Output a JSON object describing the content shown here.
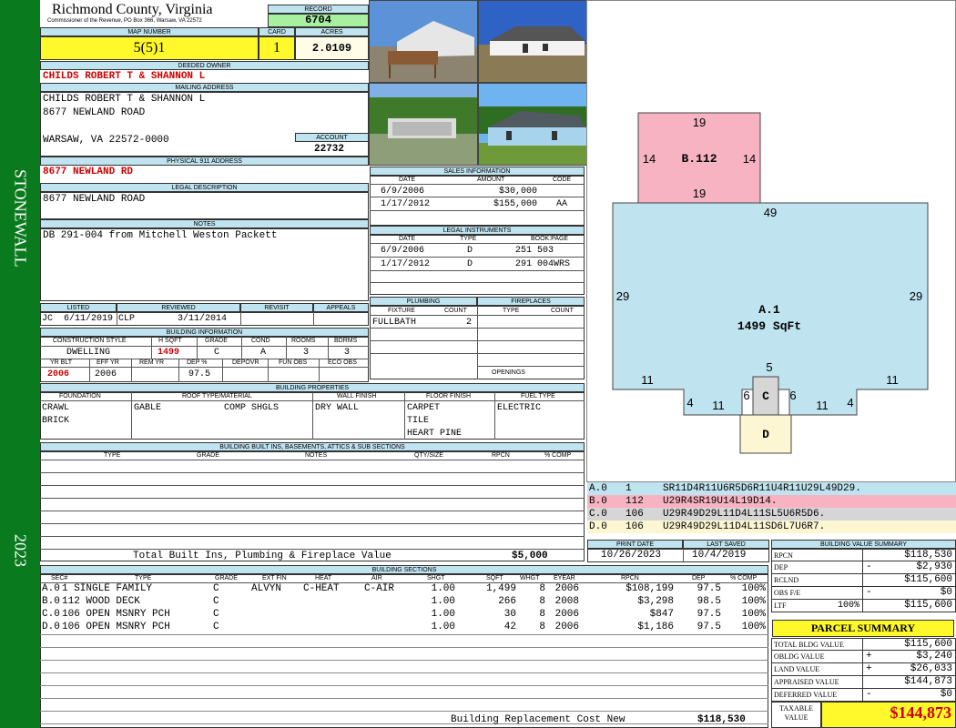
{
  "sidebar": {
    "district": "STONEWALL",
    "year": "2023"
  },
  "header": {
    "county": "Richmond County, Virginia",
    "commissioner": "Commissioner of the Revenue, PO Box 366, Warsaw, VA 22572",
    "record_label": "RECORD",
    "record": "6704",
    "map_label": "MAP NUMBER",
    "map_number": "5(5)1",
    "card_label": "CARD",
    "card": "1",
    "acres_label": "ACRES",
    "acres": "2.0109"
  },
  "owner": {
    "label": "DEEDED OWNER",
    "value": "CHILDS ROBERT T & SHANNON L"
  },
  "mailing": {
    "label": "MAILING ADDRESS",
    "line1": "CHILDS ROBERT T & SHANNON L",
    "line2": "8677 NEWLAND ROAD",
    "line3": "WARSAW, VA 22572-0000",
    "account_label": "ACCOUNT",
    "account": "22732"
  },
  "physical": {
    "label": "PHYSICAL 911 ADDRESS",
    "value": "8677 NEWLAND RD"
  },
  "legal": {
    "label": "LEGAL DESCRIPTION",
    "value": "8677 NEWLAND ROAD"
  },
  "notes": {
    "label": "NOTES",
    "value": "DB 291-004 from Mitchell Weston Packett"
  },
  "sales": {
    "label": "SALES INFORMATION",
    "headers": [
      "DATE",
      "AMOUNT",
      "CODE"
    ],
    "rows": [
      [
        "6/9/2006",
        "$30,000",
        ""
      ],
      [
        "1/17/2012",
        "$155,000",
        "AA"
      ]
    ]
  },
  "legal_instruments": {
    "label": "LEGAL INSTRUMENTS",
    "headers": [
      "DATE",
      "TYPE",
      "BOOK:PAGE"
    ],
    "rows": [
      [
        "6/9/2006",
        "D",
        "251 503"
      ],
      [
        "1/17/2012",
        "D",
        "291 004WRS"
      ]
    ]
  },
  "listing": {
    "headers": [
      "LISTED",
      "REVIEWED",
      "REVISIT",
      "APPEALS"
    ],
    "listed_by": "JC",
    "listed": "6/11/2019",
    "reviewed_by": "CLP",
    "reviewed": "3/11/2014"
  },
  "building_info": {
    "label": "BUILDING INFORMATION",
    "headers1": [
      "CONSTRUCTION STYLE",
      "H SQFT",
      "GRADE",
      "COND",
      "ROOMS",
      "BDRMS"
    ],
    "values1": [
      "DWELLING",
      "1499",
      "C",
      "A",
      "3",
      "3"
    ],
    "headers2": [
      "YR BLT",
      "EFF YR",
      "REM YR",
      "DEP %",
      "DEPOVR",
      "FUN OBS",
      "ECO OBS"
    ],
    "values2": [
      "2006",
      "2006",
      "",
      "97.5",
      "",
      "",
      ""
    ]
  },
  "plumbing": {
    "label": "PLUMBING",
    "headers": [
      "FIXTURE",
      "COUNT"
    ],
    "rows": [
      [
        "FULLBATH",
        "2"
      ]
    ]
  },
  "fireplaces": {
    "label": "FIREPLACES",
    "headers": [
      "TYPE",
      "COUNT"
    ],
    "openings_label": "OPENINGS"
  },
  "properties": {
    "label": "BUILDING PROPERTIES",
    "headers": [
      "FOUNDATION",
      "ROOF TYPE/MATERIAL",
      "WALL FINISH",
      "FLOOR FINISH",
      "FUEL TYPE"
    ],
    "foundation": [
      "CRAWL",
      "BRICK"
    ],
    "roof_type": "GABLE",
    "roof_material": "COMP SHGLS",
    "wall": "DRY WALL",
    "floor": [
      "CARPET",
      "TILE",
      "HEART PINE"
    ],
    "fuel": "ELECTRIC"
  },
  "builtins": {
    "label": "BUILDING BUILT INS, BASEMENTS, ATTICS & SUB SECTIONS",
    "headers": [
      "TYPE",
      "GRADE",
      "NOTES",
      "QTY/SIZE",
      "RPCN",
      "% COMP"
    ],
    "total_label": "Total Built Ins, Plumbing & Fireplace Value",
    "total": "$5,000"
  },
  "dates": {
    "print_label": "PRINT DATE",
    "print": "10/26/2023",
    "saved_label": "LAST SAVED",
    "saved": "10/4/2019"
  },
  "sketch": {
    "B": {
      "label": "B.112",
      "top": "19",
      "bottom": "19",
      "left": "14",
      "right": "14"
    },
    "A": {
      "label": "A.1",
      "area": "1499 SqFt",
      "top": "49",
      "left": "29",
      "right": "29",
      "b11l": "11",
      "b4l": "4",
      "b11lb": "11",
      "b11rb": "11",
      "b4r": "4",
      "b11r": "11"
    },
    "C": {
      "label": "C",
      "top": "5",
      "left": "6",
      "right": "6"
    },
    "D": {
      "label": "D"
    }
  },
  "sketch_codes": [
    {
      "sec": "A.0",
      "code": "1",
      "vec": "SR11D4R11U6R5D6R11U4R11U29L49D29.",
      "color": "#bfe3ef"
    },
    {
      "sec": "B.0",
      "code": "112",
      "vec": "U29R4SR19U14L19D14.",
      "color": "#f7b3c2"
    },
    {
      "sec": "C.0",
      "code": "106",
      "vec": "U29R49D29L11D4L11SL5U6R5D6.",
      "color": "#d6d6d6"
    },
    {
      "sec": "D.0",
      "code": "106",
      "vec": "U29R49D29L11D4L11SD6L7U6R7.",
      "color": "#fcf7d2"
    }
  ],
  "value_summary": {
    "label": "BUILDING VALUE SUMMARY",
    "rows": [
      {
        "k": "RPCN",
        "s": "",
        "v": "$118,530"
      },
      {
        "k": "DEP",
        "s": "-",
        "v": "$2,930"
      },
      {
        "k": "RCLND",
        "s": "",
        "v": "$115,600"
      },
      {
        "k": "OBS F/E",
        "s": "-",
        "v": "$0"
      },
      {
        "k": "LTF",
        "s": "100%",
        "v": "$115,600"
      }
    ]
  },
  "parcel": {
    "label": "PARCEL SUMMARY",
    "rows": [
      {
        "k": "TOTAL BLDG VALUE",
        "s": "",
        "v": "$115,600"
      },
      {
        "k": "OBLDG VALUE",
        "s": "+",
        "v": "$3,240"
      },
      {
        "k": "LAND VALUE",
        "s": "+",
        "v": "$26,033"
      },
      {
        "k": "APPRAISED VALUE",
        "s": "",
        "v": "$144,873"
      },
      {
        "k": "DEFERRED VALUE",
        "s": "-",
        "v": "$0"
      }
    ],
    "taxable_label": "TAXABLE VALUE",
    "taxable": "$144,873"
  },
  "sections": {
    "label": "BUILDING SECTIONS",
    "headers": [
      "SEC#",
      "TYPE",
      "GRADE",
      "EXT FIN",
      "HEAT",
      "AIR",
      "SHGT",
      "SQFT",
      "WHGT",
      "EYEAR",
      "RPCN",
      "DEP",
      "% COMP"
    ],
    "rows": [
      [
        "A.0",
        "1 SINGLE FAMILY",
        "C",
        "ALVYN",
        "C-HEAT",
        "C-AIR",
        "1.00",
        "1,499",
        "8",
        "2006",
        "$108,199",
        "97.5",
        "100%"
      ],
      [
        "B.0",
        "112 WOOD DECK",
        "C",
        "",
        "",
        "",
        "1.00",
        "266",
        "8",
        "2008",
        "$3,298",
        "98.5",
        "100%"
      ],
      [
        "C.0",
        "106 OPEN MSNRY PCH",
        "C",
        "",
        "",
        "",
        "1.00",
        "30",
        "8",
        "2006",
        "$847",
        "97.5",
        "100%"
      ],
      [
        "D.0",
        "106 OPEN MSNRY PCH",
        "C",
        "",
        "",
        "",
        "1.00",
        "42",
        "8",
        "2006",
        "$1,186",
        "97.5",
        "100%"
      ]
    ],
    "total_label": "Building Replacement Cost New",
    "total": "$118,530"
  }
}
